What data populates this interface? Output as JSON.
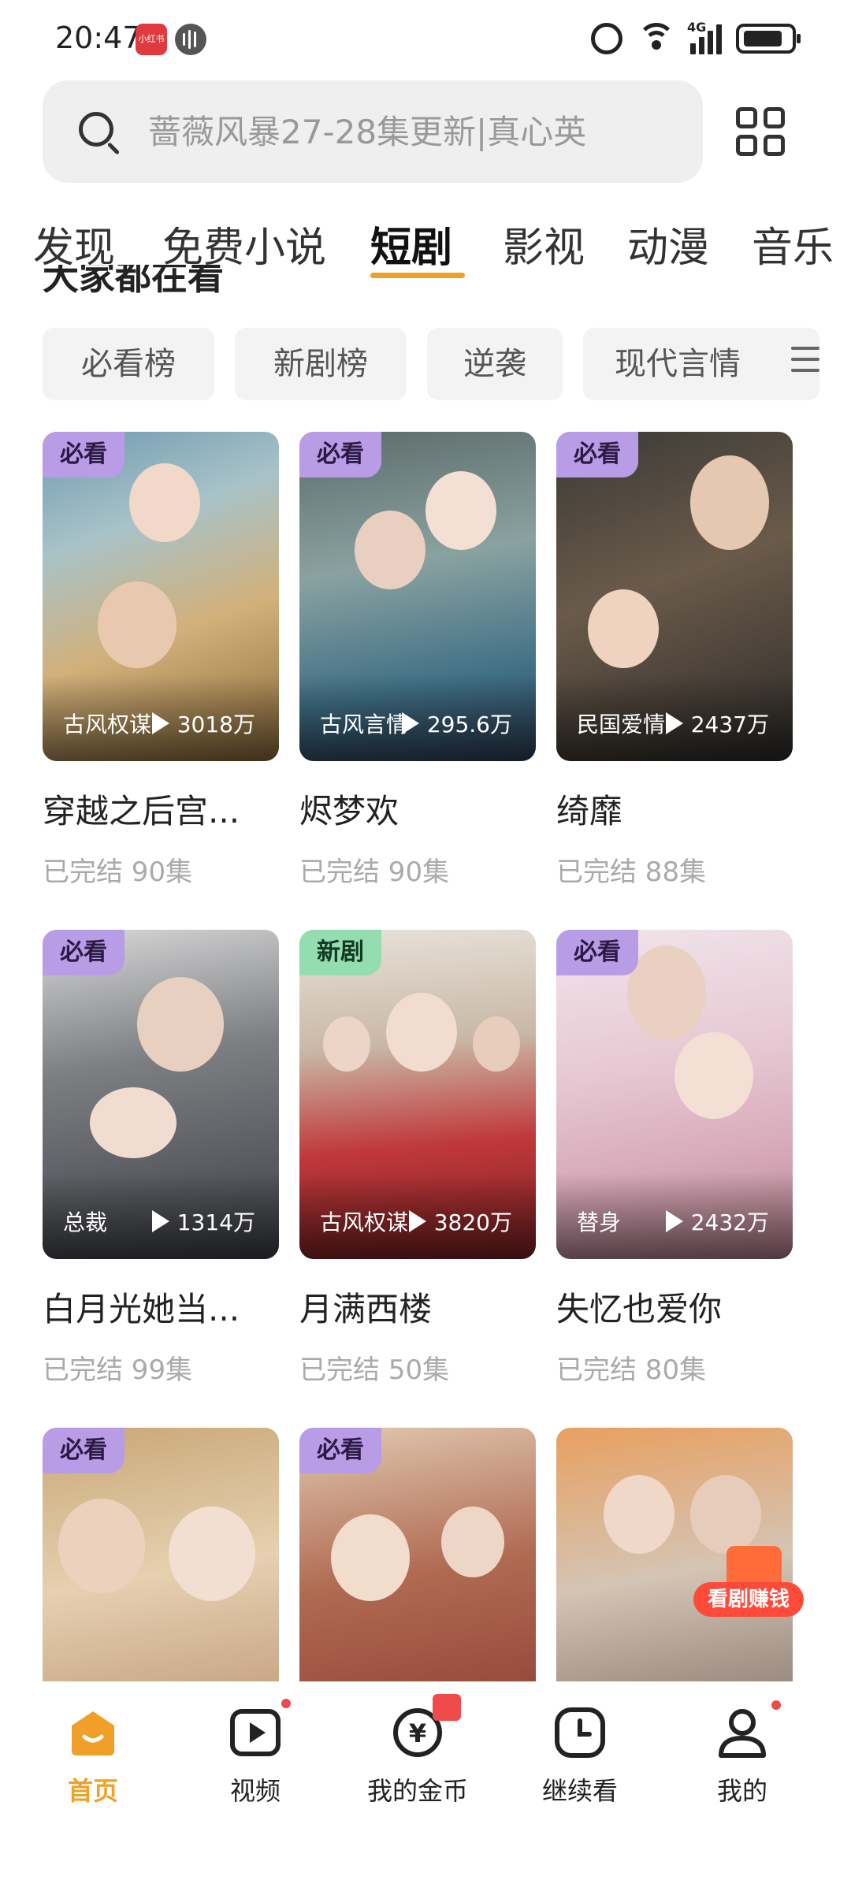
{
  "status_bar": {
    "time": "20:47",
    "app_badge": "小红书",
    "network": "4G"
  },
  "search": {
    "placeholder": "蔷薇风暴27-28集更新|真心英"
  },
  "top_tabs": [
    {
      "label": "发现",
      "active": false
    },
    {
      "label": "免费小说",
      "active": false
    },
    {
      "label": "短剧",
      "active": true
    },
    {
      "label": "影视",
      "active": false
    },
    {
      "label": "动漫",
      "active": false
    },
    {
      "label": "音乐",
      "active": false
    }
  ],
  "section_title_partial": "大家都在看",
  "chips": [
    {
      "label": "必看榜"
    },
    {
      "label": "新剧榜"
    },
    {
      "label": "逆袭"
    },
    {
      "label": "现代言情"
    }
  ],
  "colors": {
    "accent": "#f0a028",
    "badge_must": "#b99ce6",
    "badge_new": "#93ddb0",
    "notify": "#f04a4a"
  },
  "dramas": [
    {
      "badge": "必看",
      "genre": "古风权谋",
      "views": "3018万",
      "title": "穿越之后宫...",
      "meta": "已完结 90集"
    },
    {
      "badge": "必看",
      "genre": "古风言情",
      "views": "295.6万",
      "title": "烬梦欢",
      "meta": "已完结 90集"
    },
    {
      "badge": "必看",
      "genre": "民国爱情",
      "views": "2437万",
      "title": "绮靡",
      "meta": "已完结 88集"
    },
    {
      "badge": "必看",
      "genre": "总裁",
      "views": "1314万",
      "title": "白月光她当...",
      "meta": "已完结 99集"
    },
    {
      "badge": "新剧",
      "genre": "古风权谋",
      "views": "3820万",
      "title": "月满西楼",
      "meta": "已完结 50集"
    },
    {
      "badge": "必看",
      "genre": "替身",
      "views": "2432万",
      "title": "失忆也爱你",
      "meta": "已完结 80集"
    },
    {
      "badge": "必看"
    },
    {
      "badge": "必看"
    },
    {
      "badge": ""
    }
  ],
  "reward_float": {
    "label": "看剧赚钱"
  },
  "bottom_nav": [
    {
      "label": "首页",
      "active": true
    },
    {
      "label": "视频",
      "active": false
    },
    {
      "label": "我的金币",
      "active": false
    },
    {
      "label": "继续看",
      "active": false
    },
    {
      "label": "我的",
      "active": false
    }
  ]
}
